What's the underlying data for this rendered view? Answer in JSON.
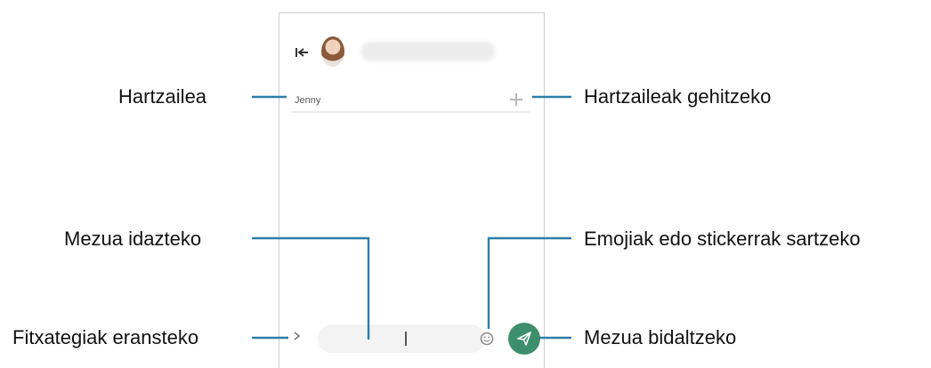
{
  "header": {
    "contact_name": ""
  },
  "recipient": {
    "value": "Jenny"
  },
  "composer": {
    "placeholder": ""
  },
  "callouts": {
    "recipient": "Hartzailea",
    "add_recipients": "Hartzaileak gehitzeko",
    "write_message": "Mezua idazteko",
    "emoji_stickers": "Emojiak edo stickerrak sartzeko",
    "attach_files": "Fitxategiak eransteko",
    "send_message": "Mezua bidaltzeko"
  },
  "colors": {
    "send_button": "#3d8f6b",
    "callout_line": "#2b7fa8"
  },
  "icons": [
    "back-icon",
    "avatar",
    "add-icon",
    "attach-icon",
    "emoji-icon",
    "send-icon"
  ]
}
